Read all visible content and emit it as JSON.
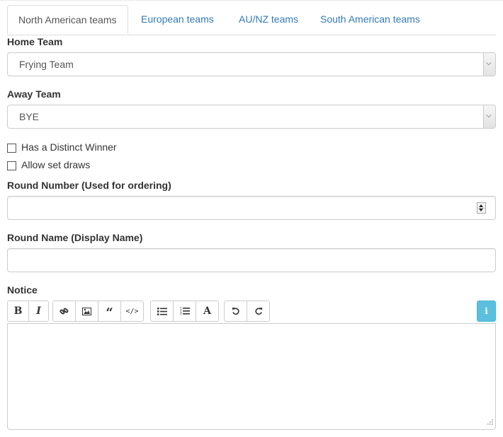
{
  "tabs": [
    {
      "label": "North American teams",
      "active": true
    },
    {
      "label": "European teams",
      "active": false
    },
    {
      "label": "AU/NZ teams",
      "active": false
    },
    {
      "label": "South American teams",
      "active": false
    }
  ],
  "home_team": {
    "label": "Home Team",
    "selected": "Frying Team"
  },
  "away_team": {
    "label": "Away Team",
    "selected": "BYE"
  },
  "checkboxes": [
    {
      "label": "Has a Distinct Winner",
      "checked": false
    },
    {
      "label": "Allow set draws",
      "checked": false
    }
  ],
  "round_number": {
    "label": "Round Number (Used for ordering)",
    "value": ""
  },
  "round_name": {
    "label": "Round Name (Display Name)",
    "value": ""
  },
  "notice": {
    "label": "Notice",
    "toolbar_groups": [
      [
        "bold-icon",
        "italic-icon"
      ],
      [
        "link-icon",
        "image-icon",
        "quote-icon",
        "code-icon"
      ],
      [
        "unordered-list-icon",
        "ordered-list-icon",
        "font-size-icon"
      ],
      [
        "undo-icon",
        "redo-icon"
      ]
    ],
    "bold_glyph": "B",
    "italic_glyph": "I",
    "font_glyph": "A",
    "info_glyph": "i",
    "info_color": "#5bc0de",
    "content": ""
  },
  "colors": {
    "link": "#337ab7",
    "border": "#cccccc"
  }
}
